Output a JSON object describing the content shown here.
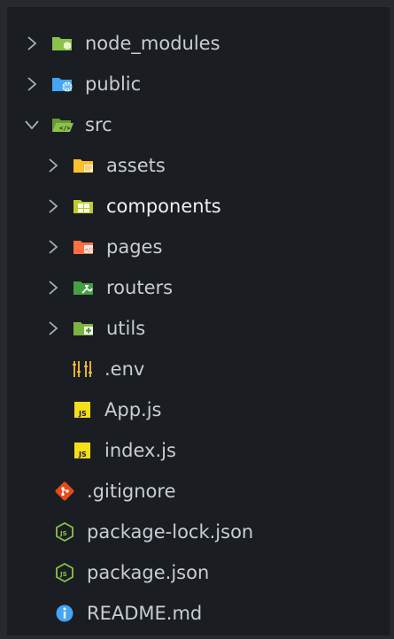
{
  "explorer": {
    "items": [
      {
        "label": "node_modules",
        "icon": "folder-node-icon",
        "chevron": "right"
      },
      {
        "label": "public",
        "icon": "folder-public-icon",
        "chevron": "right"
      },
      {
        "label": "src",
        "icon": "folder-src-open-icon",
        "chevron": "down"
      },
      {
        "label": "assets",
        "icon": "folder-assets-icon",
        "chevron": "right"
      },
      {
        "label": "components",
        "icon": "folder-components-icon",
        "chevron": "right"
      },
      {
        "label": "pages",
        "icon": "folder-pages-icon",
        "chevron": "right"
      },
      {
        "label": "routers",
        "icon": "folder-routers-icon",
        "chevron": "right"
      },
      {
        "label": "utils",
        "icon": "folder-utils-icon",
        "chevron": "right"
      },
      {
        "label": ".env",
        "icon": "env-settings-icon"
      },
      {
        "label": "App.js",
        "icon": "javascript-icon"
      },
      {
        "label": "index.js",
        "icon": "javascript-icon"
      },
      {
        "label": ".gitignore",
        "icon": "git-icon"
      },
      {
        "label": "package-lock.json",
        "icon": "nodejs-icon"
      },
      {
        "label": "package.json",
        "icon": "nodejs-icon"
      },
      {
        "label": "README.md",
        "icon": "info-icon"
      }
    ]
  },
  "colors": {
    "background": "#1a1d22",
    "text": "#c9cdd4",
    "selected_text": "#eef0f3",
    "folder_green": "#8bc34a",
    "folder_blue": "#42a5f5",
    "folder_yellow": "#fbc02d",
    "folder_red": "#ff7043",
    "js_yellow": "#f5de19",
    "git_orange": "#e64a19",
    "info_blue": "#42a5f5"
  }
}
